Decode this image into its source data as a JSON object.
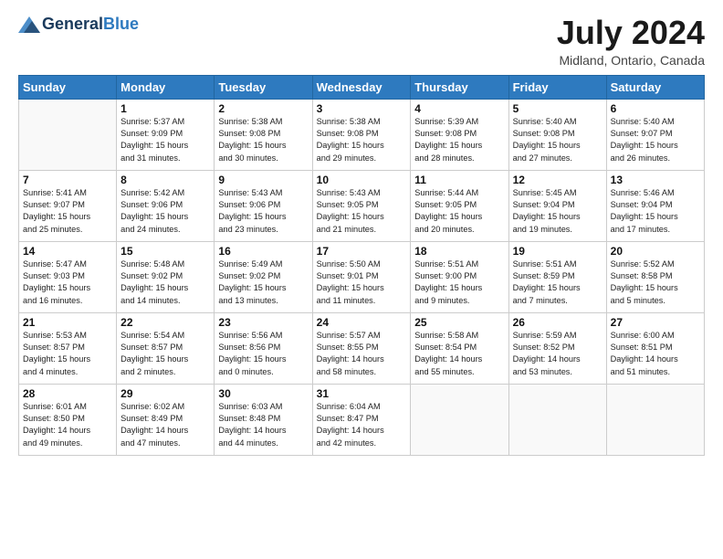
{
  "header": {
    "logo_general": "General",
    "logo_blue": "Blue",
    "month_year": "July 2024",
    "location": "Midland, Ontario, Canada"
  },
  "columns": [
    "Sunday",
    "Monday",
    "Tuesday",
    "Wednesday",
    "Thursday",
    "Friday",
    "Saturday"
  ],
  "weeks": [
    [
      {
        "day": "",
        "text": ""
      },
      {
        "day": "1",
        "text": "Sunrise: 5:37 AM\nSunset: 9:09 PM\nDaylight: 15 hours\nand 31 minutes."
      },
      {
        "day": "2",
        "text": "Sunrise: 5:38 AM\nSunset: 9:08 PM\nDaylight: 15 hours\nand 30 minutes."
      },
      {
        "day": "3",
        "text": "Sunrise: 5:38 AM\nSunset: 9:08 PM\nDaylight: 15 hours\nand 29 minutes."
      },
      {
        "day": "4",
        "text": "Sunrise: 5:39 AM\nSunset: 9:08 PM\nDaylight: 15 hours\nand 28 minutes."
      },
      {
        "day": "5",
        "text": "Sunrise: 5:40 AM\nSunset: 9:08 PM\nDaylight: 15 hours\nand 27 minutes."
      },
      {
        "day": "6",
        "text": "Sunrise: 5:40 AM\nSunset: 9:07 PM\nDaylight: 15 hours\nand 26 minutes."
      }
    ],
    [
      {
        "day": "7",
        "text": "Sunrise: 5:41 AM\nSunset: 9:07 PM\nDaylight: 15 hours\nand 25 minutes."
      },
      {
        "day": "8",
        "text": "Sunrise: 5:42 AM\nSunset: 9:06 PM\nDaylight: 15 hours\nand 24 minutes."
      },
      {
        "day": "9",
        "text": "Sunrise: 5:43 AM\nSunset: 9:06 PM\nDaylight: 15 hours\nand 23 minutes."
      },
      {
        "day": "10",
        "text": "Sunrise: 5:43 AM\nSunset: 9:05 PM\nDaylight: 15 hours\nand 21 minutes."
      },
      {
        "day": "11",
        "text": "Sunrise: 5:44 AM\nSunset: 9:05 PM\nDaylight: 15 hours\nand 20 minutes."
      },
      {
        "day": "12",
        "text": "Sunrise: 5:45 AM\nSunset: 9:04 PM\nDaylight: 15 hours\nand 19 minutes."
      },
      {
        "day": "13",
        "text": "Sunrise: 5:46 AM\nSunset: 9:04 PM\nDaylight: 15 hours\nand 17 minutes."
      }
    ],
    [
      {
        "day": "14",
        "text": "Sunrise: 5:47 AM\nSunset: 9:03 PM\nDaylight: 15 hours\nand 16 minutes."
      },
      {
        "day": "15",
        "text": "Sunrise: 5:48 AM\nSunset: 9:02 PM\nDaylight: 15 hours\nand 14 minutes."
      },
      {
        "day": "16",
        "text": "Sunrise: 5:49 AM\nSunset: 9:02 PM\nDaylight: 15 hours\nand 13 minutes."
      },
      {
        "day": "17",
        "text": "Sunrise: 5:50 AM\nSunset: 9:01 PM\nDaylight: 15 hours\nand 11 minutes."
      },
      {
        "day": "18",
        "text": "Sunrise: 5:51 AM\nSunset: 9:00 PM\nDaylight: 15 hours\nand 9 minutes."
      },
      {
        "day": "19",
        "text": "Sunrise: 5:51 AM\nSunset: 8:59 PM\nDaylight: 15 hours\nand 7 minutes."
      },
      {
        "day": "20",
        "text": "Sunrise: 5:52 AM\nSunset: 8:58 PM\nDaylight: 15 hours\nand 5 minutes."
      }
    ],
    [
      {
        "day": "21",
        "text": "Sunrise: 5:53 AM\nSunset: 8:57 PM\nDaylight: 15 hours\nand 4 minutes."
      },
      {
        "day": "22",
        "text": "Sunrise: 5:54 AM\nSunset: 8:57 PM\nDaylight: 15 hours\nand 2 minutes."
      },
      {
        "day": "23",
        "text": "Sunrise: 5:56 AM\nSunset: 8:56 PM\nDaylight: 15 hours\nand 0 minutes."
      },
      {
        "day": "24",
        "text": "Sunrise: 5:57 AM\nSunset: 8:55 PM\nDaylight: 14 hours\nand 58 minutes."
      },
      {
        "day": "25",
        "text": "Sunrise: 5:58 AM\nSunset: 8:54 PM\nDaylight: 14 hours\nand 55 minutes."
      },
      {
        "day": "26",
        "text": "Sunrise: 5:59 AM\nSunset: 8:52 PM\nDaylight: 14 hours\nand 53 minutes."
      },
      {
        "day": "27",
        "text": "Sunrise: 6:00 AM\nSunset: 8:51 PM\nDaylight: 14 hours\nand 51 minutes."
      }
    ],
    [
      {
        "day": "28",
        "text": "Sunrise: 6:01 AM\nSunset: 8:50 PM\nDaylight: 14 hours\nand 49 minutes."
      },
      {
        "day": "29",
        "text": "Sunrise: 6:02 AM\nSunset: 8:49 PM\nDaylight: 14 hours\nand 47 minutes."
      },
      {
        "day": "30",
        "text": "Sunrise: 6:03 AM\nSunset: 8:48 PM\nDaylight: 14 hours\nand 44 minutes."
      },
      {
        "day": "31",
        "text": "Sunrise: 6:04 AM\nSunset: 8:47 PM\nDaylight: 14 hours\nand 42 minutes."
      },
      {
        "day": "",
        "text": ""
      },
      {
        "day": "",
        "text": ""
      },
      {
        "day": "",
        "text": ""
      }
    ]
  ]
}
